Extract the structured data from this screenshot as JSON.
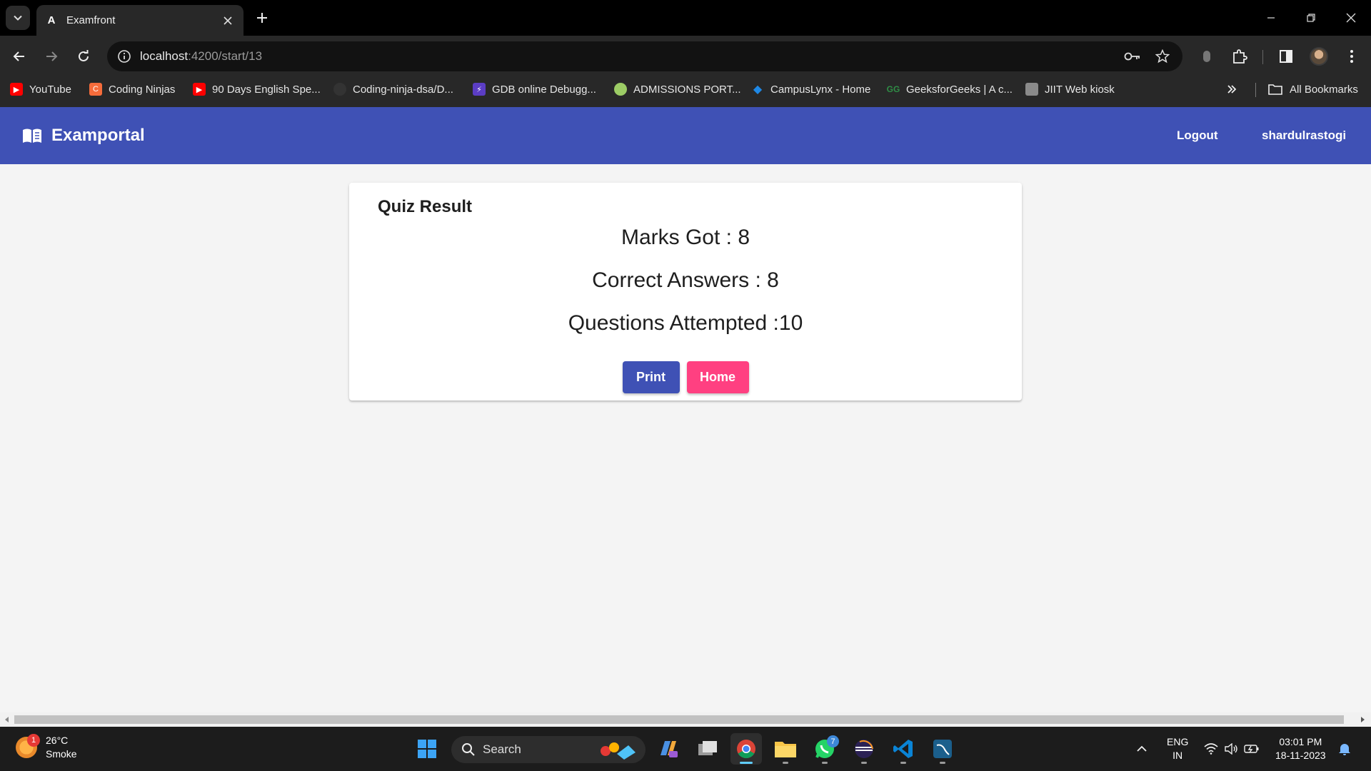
{
  "browser": {
    "tab": {
      "title": "Examfront",
      "favicon": "angular-icon"
    },
    "url": {
      "host": "localhost",
      "path": ":4200/start/13"
    },
    "bookmarks": [
      {
        "label": "YouTube",
        "icon": "youtube-icon",
        "color": "#ff0000"
      },
      {
        "label": "Coding Ninjas",
        "icon": "coding-ninjas-icon",
        "color": "#f66c3b"
      },
      {
        "label": "90 Days English Spe...",
        "icon": "youtube-icon",
        "color": "#ff0000"
      },
      {
        "label": "Coding-ninja-dsa/D...",
        "icon": "github-icon",
        "color": "#333333"
      },
      {
        "label": "GDB online Debugg...",
        "icon": "gdb-icon",
        "color": "#5b3dc4"
      },
      {
        "label": "ADMISSIONS PORT...",
        "icon": "globe-icon",
        "color": "#9ccc65"
      },
      {
        "label": "CampusLynx - Home",
        "icon": "campuslynx-icon",
        "color": "#1e88e5"
      },
      {
        "label": "GeeksforGeeks | A c...",
        "icon": "geeksforgeeks-icon",
        "color": "#2f8d46"
      },
      {
        "label": "JIIT Web kiosk",
        "icon": "kiosk-icon",
        "color": "#8a8a8a"
      }
    ],
    "all_bookmarks_label": "All Bookmarks"
  },
  "app": {
    "brand": "Examportal",
    "logout_label": "Logout",
    "username": "shardulrastogi",
    "primary_color": "#3f51b5",
    "accent_color": "#ff4081"
  },
  "result": {
    "title": "Quiz Result",
    "marks_got": "Marks Got : 8",
    "correct_answers": "Correct Answers : 8",
    "questions_attempted": "Questions Attempted :10",
    "print_label": "Print",
    "home_label": "Home"
  },
  "taskbar": {
    "weather_temp": "26°C",
    "weather_desc": "Smoke",
    "weather_badge": "1",
    "search_placeholder": "Search",
    "whatsapp_badge": "7",
    "lang_line1": "ENG",
    "lang_line2": "IN",
    "time": "03:01 PM",
    "date": "18-11-2023"
  }
}
